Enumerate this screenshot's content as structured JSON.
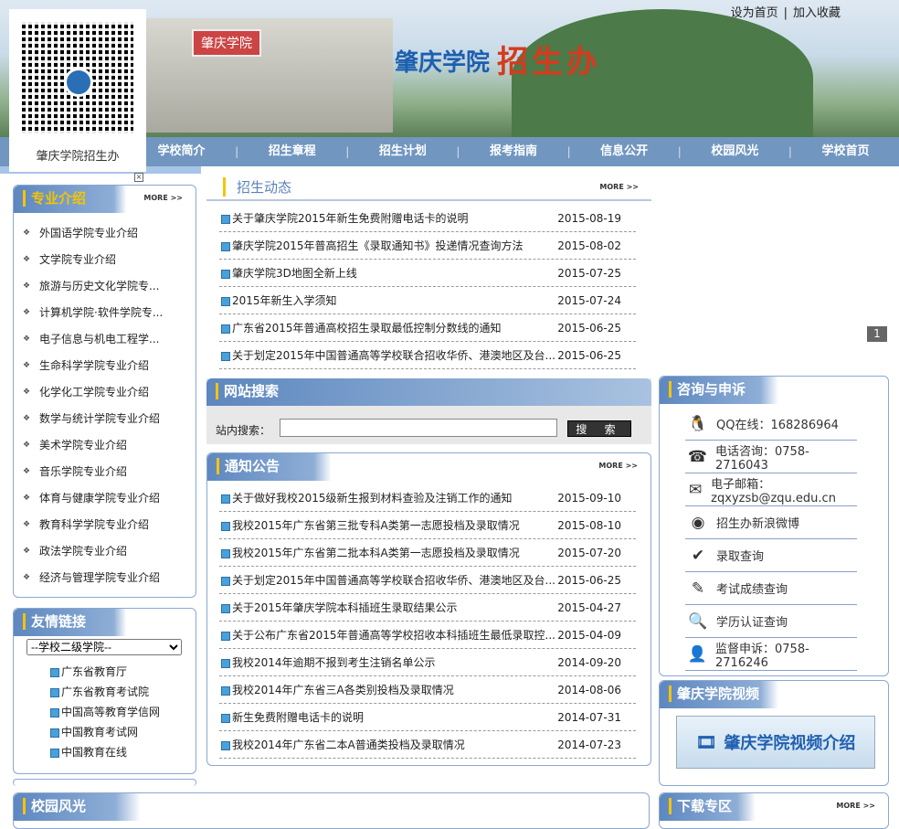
{
  "header": {
    "banner_title": "肇庆学院",
    "banner_subtitle": "招生办",
    "gate_sign": "肇庆学院",
    "top_links": [
      "设为首页",
      "加入收藏"
    ],
    "separator": "|"
  },
  "qr": {
    "caption": "肇庆学院招生办",
    "close": "×"
  },
  "nav": [
    "学校简介",
    "招生章程",
    "招生计划",
    "报考指南",
    "信息公开",
    "校园风光",
    "学校首页"
  ],
  "more_label": "MORE >>",
  "majors": {
    "title": "专业介绍",
    "items": [
      "外国语学院专业介绍",
      "文学院专业介绍",
      "旅游与历史文化学院专...",
      "计算机学院·软件学院专...",
      "电子信息与机电工程学...",
      "生命科学学院专业介绍",
      "化学化工学院专业介绍",
      "数学与统计学院专业介绍",
      "美术学院专业介绍",
      "音乐学院专业介绍",
      "体育与健康学院专业介绍",
      "教育科学学院专业介绍",
      "政法学院专业介绍",
      "经济与管理学院专业介绍"
    ]
  },
  "friend_links": {
    "title": "友情链接",
    "select": "--学校二级学院--",
    "items": [
      "广东省教育厅",
      "广东省教育考试院",
      "中国高等教育学信网",
      "中国教育考试网",
      "中国教育在线"
    ]
  },
  "campus": {
    "title": "校园风光"
  },
  "admission_news": {
    "title": "招生动态",
    "items": [
      {
        "title": "关于肇庆学院2015年新生免费附赠电话卡的说明",
        "date": "2015-08-19"
      },
      {
        "title": "肇庆学院2015年普高招生《录取通知书》投递情况查询方法",
        "date": "2015-08-02"
      },
      {
        "title": "肇庆学院3D地图全新上线",
        "date": "2015-07-25"
      },
      {
        "title": "2015年新生入学须知",
        "date": "2015-07-24"
      },
      {
        "title": "广东省2015年普通高校招生录取最低控制分数线的通知",
        "date": "2015-06-25"
      },
      {
        "title": "关于划定2015年中国普通高等学校联合招收华侨、港澳地区及台...",
        "date": "2015-06-25"
      }
    ]
  },
  "search": {
    "title": "网站搜索",
    "label": "站内搜索：",
    "value": "",
    "button": "搜 索"
  },
  "notices": {
    "title": "通知公告",
    "items": [
      {
        "title": "关于做好我校2015级新生报到材料查验及注销工作的通知",
        "date": "2015-09-10"
      },
      {
        "title": "我校2015年广东省第三批专科A类第一志愿投档及录取情况",
        "date": "2015-08-10"
      },
      {
        "title": "我校2015年广东省第二批本科A类第一志愿投档及录取情况",
        "date": "2015-07-20"
      },
      {
        "title": "关于划定2015年中国普通高等学校联合招收华侨、港澳地区及台...",
        "date": "2015-06-25"
      },
      {
        "title": "关于2015年肇庆学院本科插班生录取结果公示",
        "date": "2015-04-27"
      },
      {
        "title": "关于公布广东省2015年普通高等学校招收本科插班生最低录取控...",
        "date": "2015-04-09"
      },
      {
        "title": "我校2014年逾期不报到考生注销名单公示",
        "date": "2014-09-20"
      },
      {
        "title": "我校2014年广东省三A各类别投档及录取情况",
        "date": "2014-08-06"
      },
      {
        "title": "新生免费附赠电话卡的说明",
        "date": "2014-07-31"
      },
      {
        "title": "我校2014年广东省二本A普通类投档及录取情况",
        "date": "2014-07-23"
      }
    ]
  },
  "slider_page": "1",
  "consult": {
    "title": "咨询与申诉",
    "items": [
      {
        "icon": "qq-icon",
        "glyph": "🐧",
        "text": "QQ在线：168286964"
      },
      {
        "icon": "phone-icon",
        "glyph": "☎",
        "text": "电话咨询：0758-2716043"
      },
      {
        "icon": "mail-icon",
        "glyph": "✉",
        "text": "电子邮箱：zqxyzsb@zqu.edu.cn"
      },
      {
        "icon": "weibo-icon",
        "glyph": "◉",
        "text": "招生办新浪微博"
      },
      {
        "icon": "search-icon",
        "glyph": "✔",
        "text": "录取查询"
      },
      {
        "icon": "score-icon",
        "glyph": "✎",
        "text": "考试成绩查询"
      },
      {
        "icon": "degree-icon",
        "glyph": "🔍",
        "text": "学历认证查询"
      },
      {
        "icon": "supervisor-icon",
        "glyph": "👤",
        "text": "监督申诉：0758-2716246"
      }
    ]
  },
  "video": {
    "title": "肇庆学院视频",
    "banner": "肇庆学院视频介绍"
  },
  "downloads": {
    "title": "下载专区"
  },
  "colors": {
    "nav": "#7196c0",
    "accent": "#f5c400",
    "border": "#8aa8d0"
  }
}
